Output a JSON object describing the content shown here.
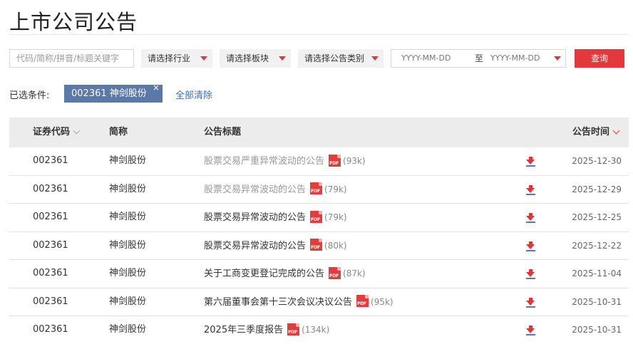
{
  "page": {
    "title": "上市公司公告"
  },
  "filters": {
    "search_placeholder": "代码/简称/拼音/标题关键字",
    "industry_label": "请选择行业",
    "board_label": "请选择板块",
    "category_label": "请选择公告类别",
    "date_from_placeholder": "YYYY-MM-DD",
    "date_to_label": "至",
    "date_to_placeholder": "YYYY-MM-DD",
    "query_label": "查询"
  },
  "conditions": {
    "label": "已选条件:",
    "tag_label": "002361 神剑股份",
    "tag_close": "×",
    "clear_all": "全部清除"
  },
  "table": {
    "columns": {
      "code": "证券代码",
      "name": "简称",
      "title": "公告标题",
      "time": "公告时间"
    },
    "rows": [
      {
        "code": "002361",
        "name": "神剑股份",
        "title": "股票交易严重异常波动的公告",
        "pdf": "PDF",
        "size": "(93k)",
        "date": "2025-12-30",
        "visited": true
      },
      {
        "code": "002361",
        "name": "神剑股份",
        "title": "股票交易异常波动的公告",
        "pdf": "PDF",
        "size": "(79k)",
        "date": "2025-12-29",
        "visited": true
      },
      {
        "code": "002361",
        "name": "神剑股份",
        "title": "股票交易异常波动的公告",
        "pdf": "PDF",
        "size": "(79k)",
        "date": "2025-12-25",
        "visited": false
      },
      {
        "code": "002361",
        "name": "神剑股份",
        "title": "股票交易异常波动的公告",
        "pdf": "PDF",
        "size": "(80k)",
        "date": "2025-12-22",
        "visited": false
      },
      {
        "code": "002361",
        "name": "神剑股份",
        "title": "关于工商变更登记完成的公告",
        "pdf": "PDF",
        "size": "(87k)",
        "date": "2025-11-04",
        "visited": false
      },
      {
        "code": "002361",
        "name": "神剑股份",
        "title": "第六届董事会第十三次会议决议公告",
        "pdf": "PDF",
        "size": "(95k)",
        "date": "2025-10-31",
        "visited": false
      },
      {
        "code": "002361",
        "name": "神剑股份",
        "title": "2025年三季度报告",
        "pdf": "PDF",
        "size": "(134k)",
        "date": "2025-10-31",
        "visited": false
      }
    ]
  },
  "colors": {
    "accent_red": "#e4393c",
    "tag_blue": "#5a78a8",
    "link_blue": "#3a70b5",
    "visited_gray": "#999999"
  }
}
